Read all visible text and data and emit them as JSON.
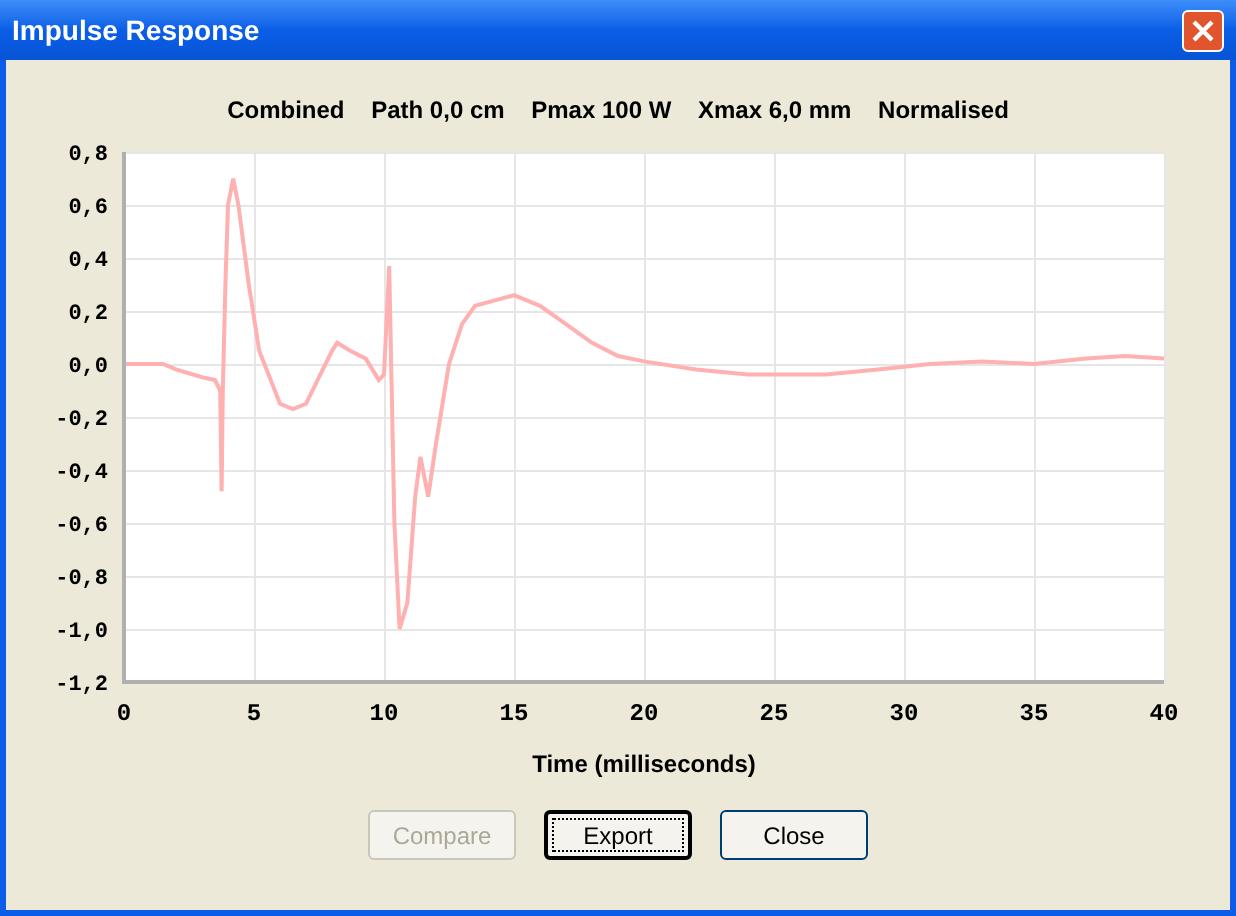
{
  "window": {
    "title": "Impulse Response"
  },
  "chart": {
    "chart_data": {
      "type": "line",
      "grid": true,
      "title": "Combined    Path 0,0 cm    Pmax 100 W    Xmax 6,0 mm    Normalised",
      "xlabel": "Time (milliseconds)",
      "xlim": [
        0,
        40
      ],
      "ylim": [
        -1.2,
        0.8
      ],
      "xticks": [
        0,
        5,
        10,
        15,
        20,
        25,
        30,
        35,
        40
      ],
      "yticks": [
        {
          "value": 0.8,
          "label": "0,8"
        },
        {
          "value": 0.6,
          "label": "0,6"
        },
        {
          "value": 0.4,
          "label": "0,4"
        },
        {
          "value": 0.2,
          "label": "0,2"
        },
        {
          "value": 0,
          "label": "0,0"
        },
        {
          "value": -0.2,
          "label": "-0,2"
        },
        {
          "value": -0.4,
          "label": "-0,4"
        },
        {
          "value": -0.6,
          "label": "-0,6"
        },
        {
          "value": -0.8,
          "label": "-0,8"
        },
        {
          "value": -1,
          "label": "-1,0"
        },
        {
          "value": -1.2,
          "label": "-1,2"
        }
      ],
      "x": [
        0,
        1.5,
        2,
        3,
        3.5,
        3.7,
        3.75,
        3.8,
        3.9,
        4.0,
        4.2,
        4.4,
        4.8,
        5.2,
        5.6,
        6.0,
        6.5,
        7,
        7.5,
        8,
        8.2,
        8.7,
        9.3,
        9.8,
        10,
        10.2,
        10.4,
        10.6,
        10.9,
        11.2,
        11.4,
        11.7,
        12,
        12.5,
        13,
        13.5,
        15,
        16,
        17,
        18,
        19,
        20,
        22,
        24,
        27,
        29,
        31,
        33,
        35,
        37,
        38.5,
        40
      ],
      "series": [
        {
          "color": "#ffb0b0",
          "values": [
            0,
            0,
            -0.02,
            -0.05,
            -0.06,
            -0.1,
            -0.48,
            -0.1,
            0.3,
            0.6,
            0.7,
            0.6,
            0.3,
            0.05,
            -0.05,
            -0.15,
            -0.17,
            -0.15,
            -0.05,
            0.05,
            0.08,
            0.05,
            0.02,
            -0.06,
            -0.04,
            0.37,
            -0.6,
            -1.0,
            -0.9,
            -0.5,
            -0.35,
            -0.5,
            -0.3,
            0.0,
            0.15,
            0.22,
            0.26,
            0.22,
            0.15,
            0.08,
            0.03,
            0.01,
            -0.02,
            -0.04,
            -0.04,
            -0.02,
            0.0,
            0.01,
            0.0,
            0.02,
            0.03,
            0.02
          ]
        }
      ]
    }
  },
  "buttons": [
    {
      "label": "Compare",
      "disabled": true,
      "focused": false
    },
    {
      "label": "Export",
      "disabled": false,
      "focused": true
    },
    {
      "label": "Close",
      "disabled": false,
      "focused": false
    }
  ]
}
